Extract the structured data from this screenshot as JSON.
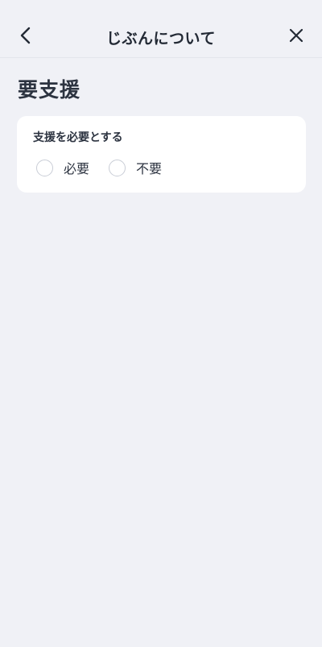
{
  "header": {
    "title": "じぶんについて",
    "back_icon": "chevron-left-icon",
    "close_icon": "close-icon"
  },
  "page": {
    "title": "要支援"
  },
  "support_card": {
    "label": "支援を必要とする",
    "options": [
      {
        "label": "必要",
        "selected": false
      },
      {
        "label": "不要",
        "selected": false
      }
    ]
  },
  "colors": {
    "background": "#f0f1f6",
    "card": "#ffffff",
    "text": "#2c3340",
    "radio_border": "#c9cdd6"
  }
}
